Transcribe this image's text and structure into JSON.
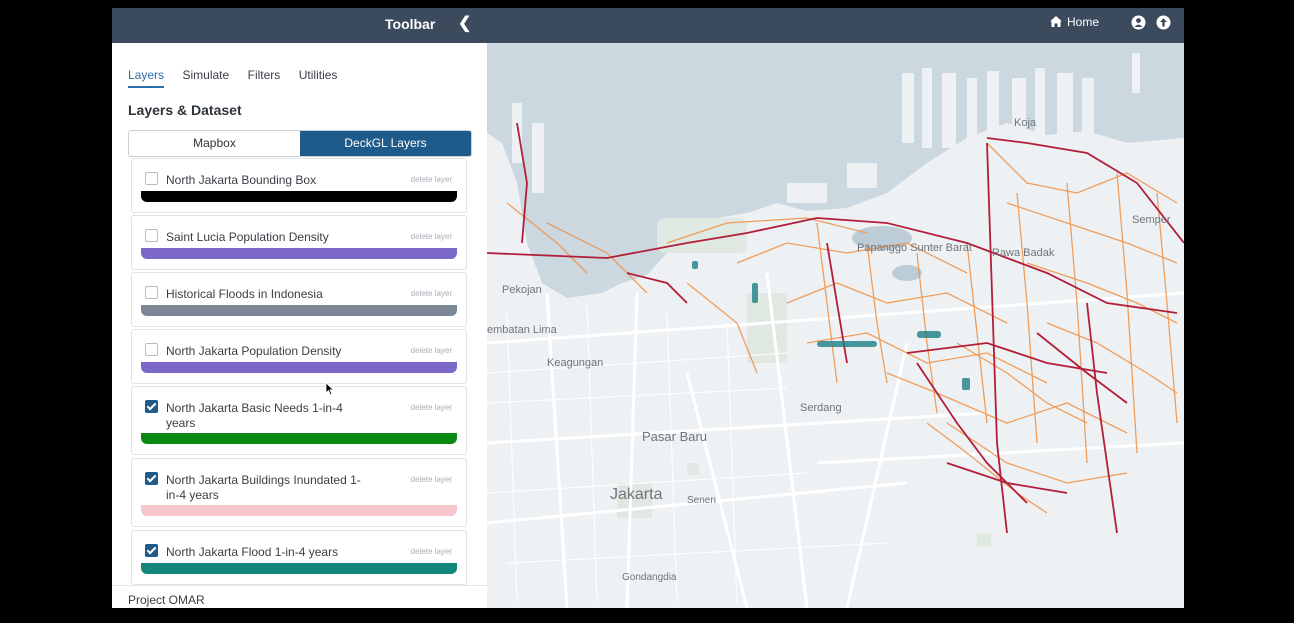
{
  "sidebar": {
    "title": "Toolbar",
    "tabs": [
      {
        "label": "Layers",
        "active": true
      },
      {
        "label": "Simulate"
      },
      {
        "label": "Filters"
      },
      {
        "label": "Utilities"
      }
    ],
    "section_title": "Layers & Dataset",
    "segments": [
      {
        "label": "Mapbox",
        "active": false
      },
      {
        "label": "DeckGL Layers",
        "active": true
      }
    ],
    "layers": [
      {
        "name": "North Jakarta Bounding Box",
        "checked": false,
        "color": "#000000",
        "delete_label": "delete layer"
      },
      {
        "name": "Saint Lucia Population Density",
        "checked": false,
        "color": "#7b68c9",
        "delete_label": "delete layer"
      },
      {
        "name": "Historical Floods in Indonesia",
        "checked": false,
        "color": "#7b8794",
        "delete_label": "delete layer"
      },
      {
        "name": "North Jakarta Population Density",
        "checked": false,
        "color": "#7b68c9",
        "delete_label": "delete layer"
      },
      {
        "name": "North Jakarta Basic Needs 1-in-4 years",
        "checked": true,
        "color": "#0b8a13",
        "delete_label": "delete layer"
      },
      {
        "name": "North Jakarta Buildings Inundated 1-in-4 years",
        "checked": true,
        "color": "#f7c5cc",
        "delete_label": "delete layer"
      },
      {
        "name": "North Jakarta Flood 1-in-4 years",
        "checked": true,
        "color": "#14877d",
        "delete_label": "delete layer"
      }
    ],
    "footer": "Project OMAR"
  },
  "topbar": {
    "home_label": "Home",
    "icons": [
      "home-icon",
      "user-icon",
      "upload-icon"
    ]
  },
  "map": {
    "labels": [
      "Koja",
      "Semper",
      "Papanggo Sunter Barat",
      "Rawa Badak",
      "Pekojan",
      "embatan Lima",
      "Keagungan",
      "Serdang",
      "Pasar Baru",
      "Jakarta",
      "Senen",
      "Gondangdia"
    ]
  },
  "colors": {
    "header": "#3b4a5c",
    "accent": "#1f5b8a",
    "water": "#cbd8df",
    "land": "#eef1f3",
    "roads": "#f0944a",
    "flood_lines": "#b21e3a"
  }
}
